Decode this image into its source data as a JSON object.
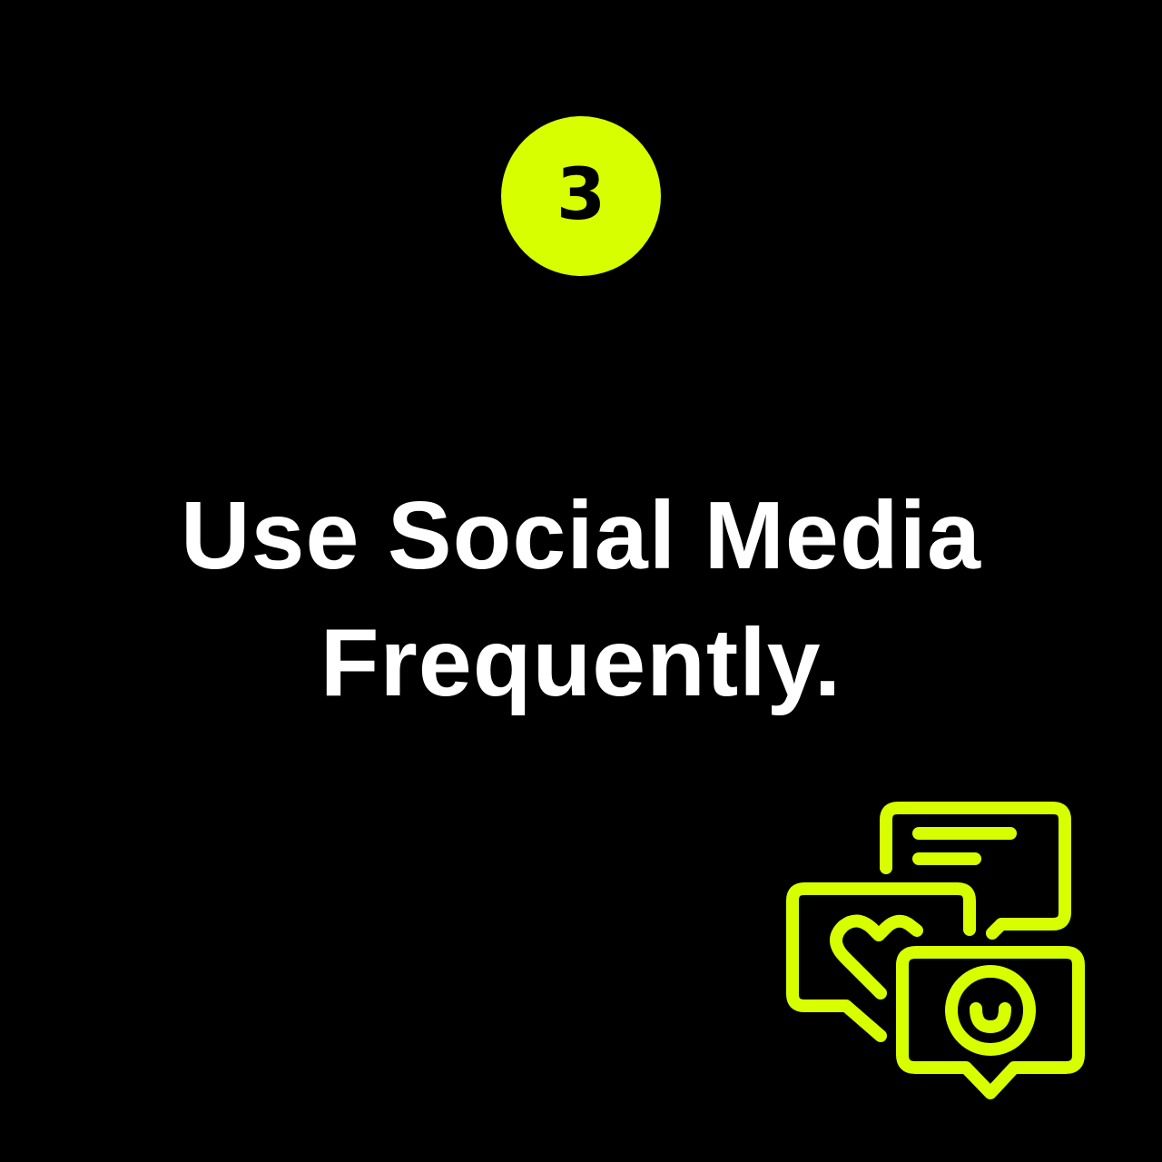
{
  "badge": {
    "number": "3"
  },
  "headline": {
    "line1": "Use Social Media",
    "line2": "Frequently."
  },
  "icon": {
    "name": "chat-bubbles-icon"
  },
  "colors": {
    "background": "#000000",
    "accent": "#D8FF00",
    "text": "#FFFFFF"
  }
}
